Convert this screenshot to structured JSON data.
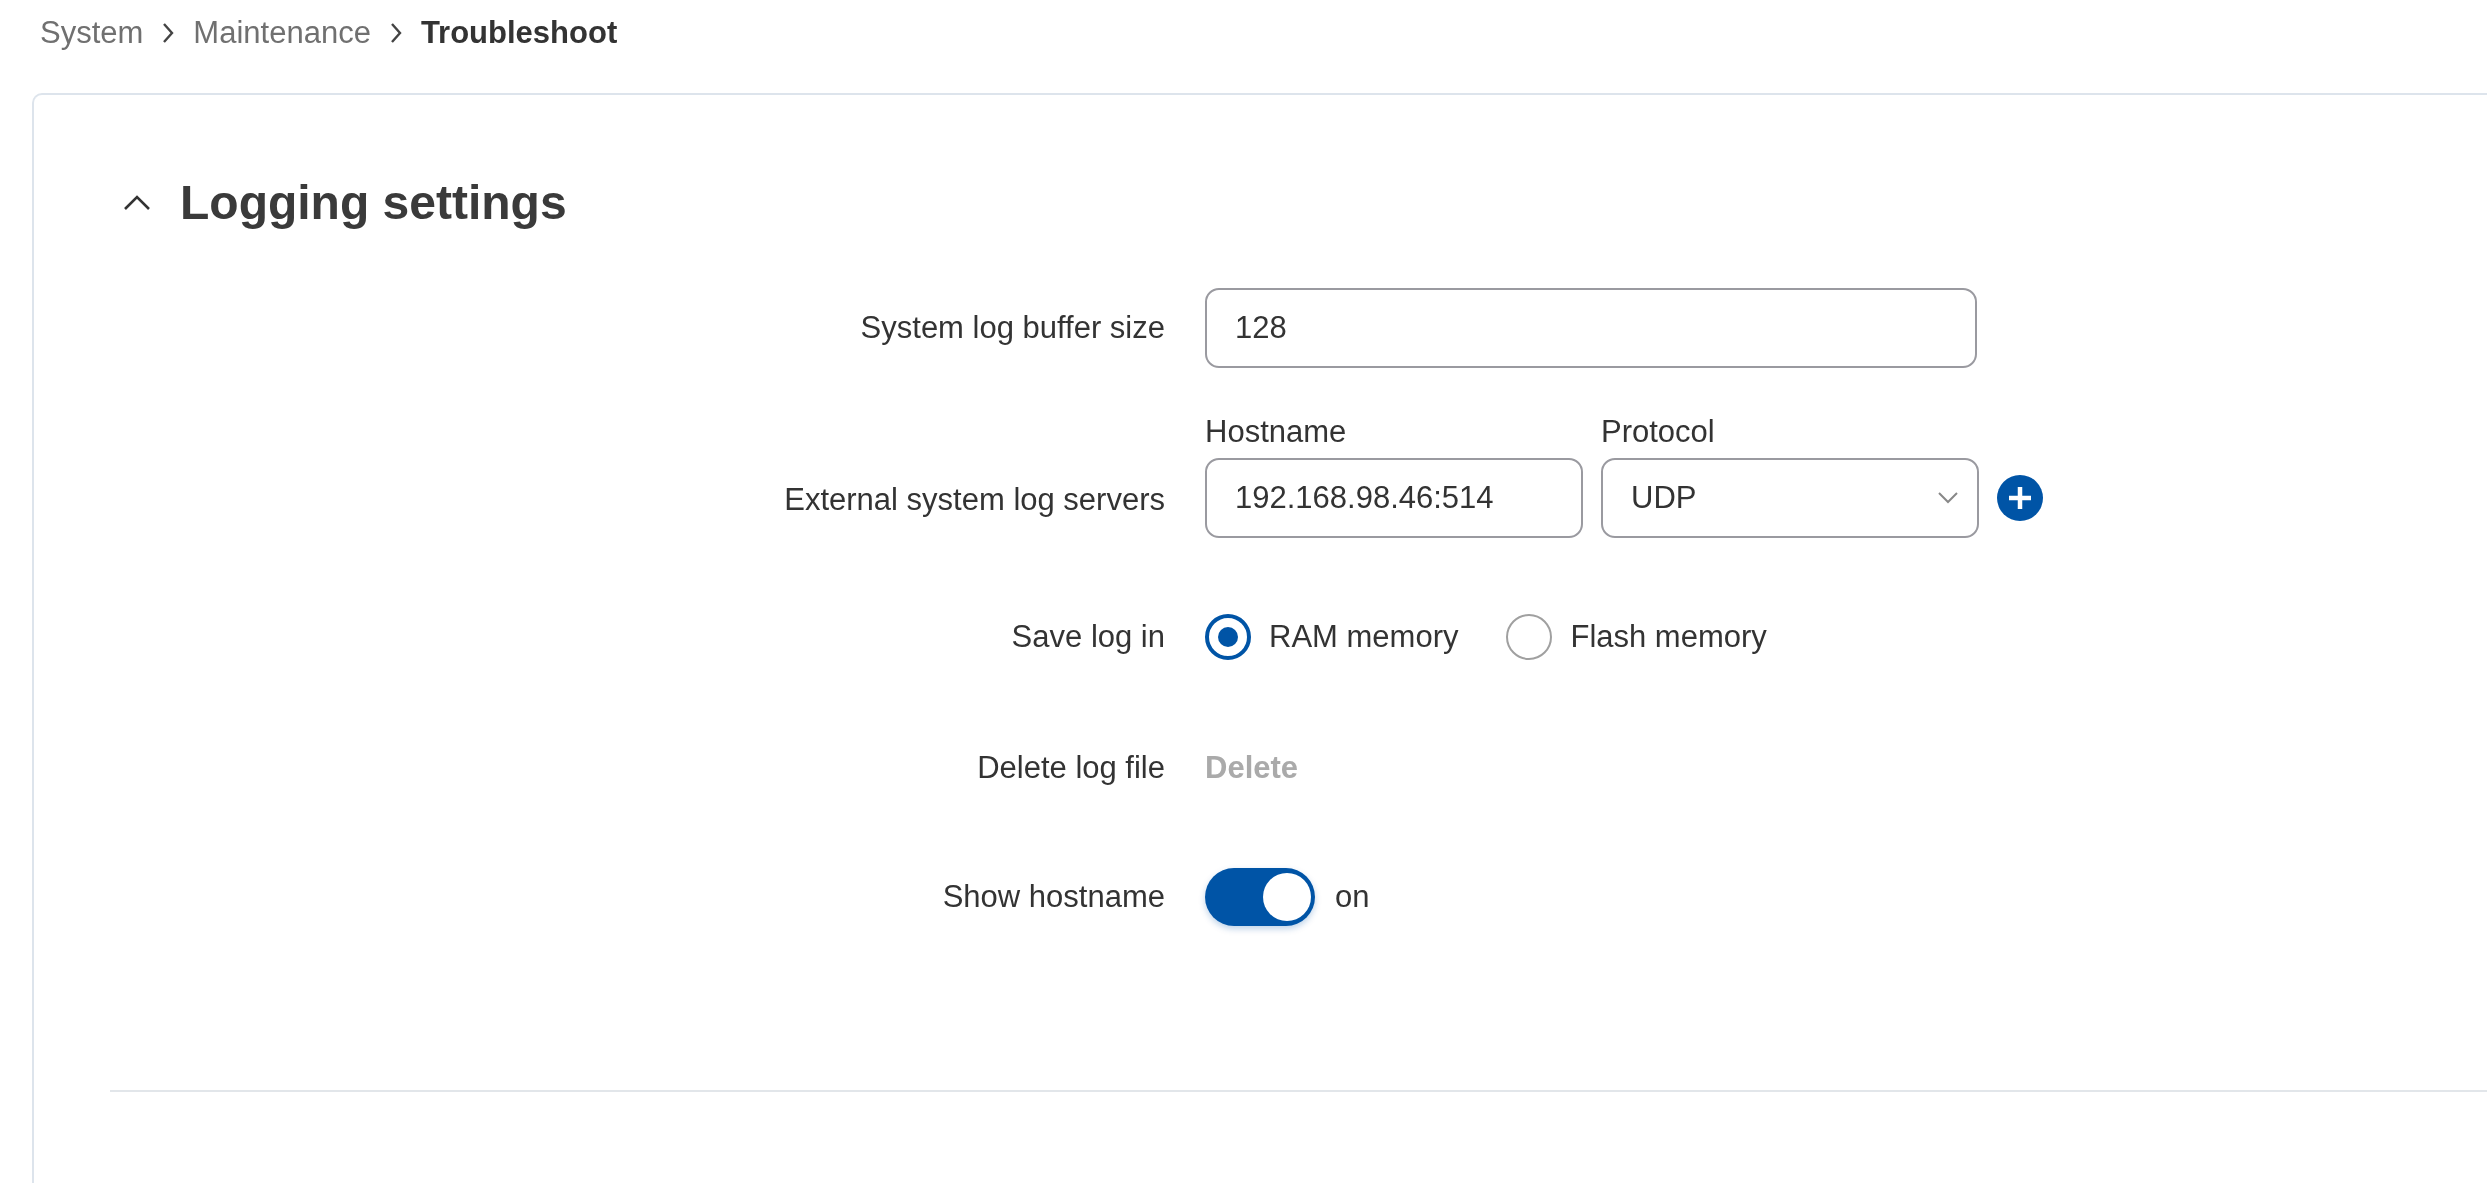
{
  "breadcrumb": [
    {
      "label": "System",
      "current": false
    },
    {
      "label": "Maintenance",
      "current": false
    },
    {
      "label": "Troubleshoot",
      "current": true
    }
  ],
  "section": {
    "title": "Logging settings",
    "expanded": true,
    "rows": [
      {
        "kind": "text",
        "label": "System log buffer size",
        "value": "128"
      },
      {
        "kind": "servers",
        "label": "External system log servers",
        "columns": [
          "Hostname",
          "Protocol"
        ],
        "hostname": "192.168.98.46:514",
        "protocol": "UDP"
      },
      {
        "kind": "radio",
        "label": "Save log in",
        "options": [
          {
            "label": "RAM memory",
            "selected": true
          },
          {
            "label": "Flash memory",
            "selected": false
          }
        ]
      },
      {
        "kind": "button",
        "label": "Delete log file",
        "button": "Delete",
        "disabled": true
      },
      {
        "kind": "toggle",
        "label": "Show hostname",
        "on": true,
        "state_text": "on"
      }
    ]
  }
}
